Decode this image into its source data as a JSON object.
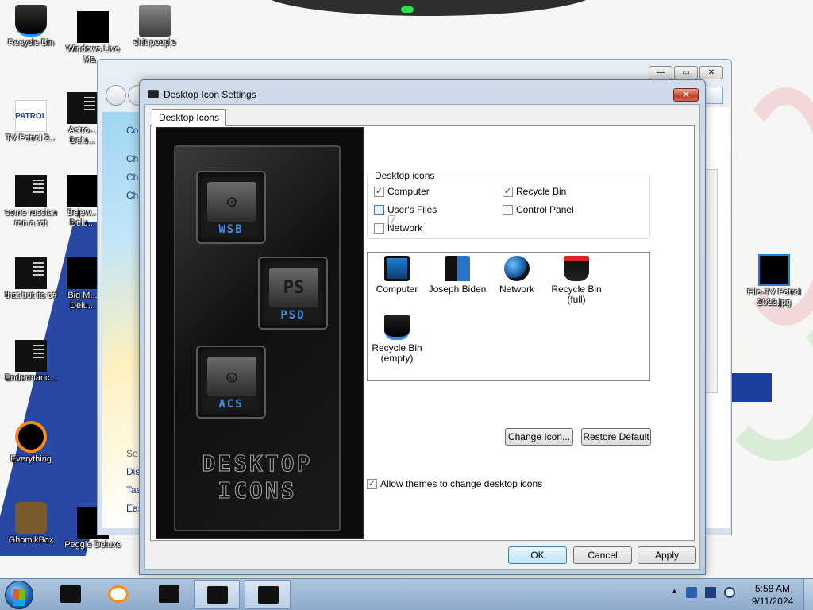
{
  "desktop": {
    "icons": [
      {
        "label": "Recycle Bin"
      },
      {
        "label": "Windows Live Ma..."
      },
      {
        "label": "shit people"
      },
      {
        "label": "TV Patrol 2..."
      },
      {
        "label": "Astro... Delu..."
      },
      {
        "label": "some russian ran a rat"
      },
      {
        "label": "Bejew... Delu..."
      },
      {
        "label": "that but its c#"
      },
      {
        "label": "Big M... Delu..."
      },
      {
        "label": "Endermanc..."
      },
      {
        "label": "Everything"
      },
      {
        "label": "GhomikBox"
      },
      {
        "label": "Peggle Deluxe"
      },
      {
        "label": "File-TV Patrol 2022.jpg"
      }
    ],
    "tv_logo": "PATROL"
  },
  "background_window": {
    "left_items": [
      "Co",
      "Ch",
      "Ch",
      "Ch",
      "Se",
      "Dis",
      "Tas",
      "Eas"
    ]
  },
  "dialog": {
    "title": "Desktop Icon Settings",
    "close_symbol": "✕",
    "tab_label": "Desktop Icons",
    "preview_art": {
      "tiles": [
        {
          "glyph": "⚙",
          "label": "WSB"
        },
        {
          "glyph": "PS",
          "label": "PSD"
        },
        {
          "glyph": "◎",
          "label": "ACS"
        }
      ],
      "title_line1": "DESKTOP",
      "title_line2": "ICONS"
    },
    "group_title": "Desktop icons",
    "checkboxes": [
      {
        "label": "Computer",
        "checked": true
      },
      {
        "label": "Recycle Bin",
        "checked": true
      },
      {
        "label": "User's Files",
        "checked": false
      },
      {
        "label": "Control Panel",
        "checked": false
      },
      {
        "label": "Network",
        "checked": false
      }
    ],
    "check_mark": "✓",
    "icon_list": [
      {
        "line1": "Computer",
        "line2": "",
        "icon": "monitor-icon"
      },
      {
        "line1": "Joseph Biden",
        "line2": "",
        "icon": "user-files-icon"
      },
      {
        "line1": "Network",
        "line2": "",
        "icon": "globe-icon"
      },
      {
        "line1": "Recycle Bin",
        "line2": "(full)",
        "icon": "recycle-bin-full-icon"
      },
      {
        "line1": "Recycle Bin",
        "line2": "(empty)",
        "icon": "recycle-bin-empty-icon"
      }
    ],
    "change_icon_label": "Change Icon...",
    "restore_default_label": "Restore Default",
    "allow_themes_label": "Allow themes to change desktop icons",
    "allow_themes_checked": true,
    "ok_label": "OK",
    "cancel_label": "Cancel",
    "apply_label": "Apply"
  },
  "taskbar": {
    "time": "5:58 AM",
    "date": "9/11/2024",
    "tray_arrow": "▲"
  },
  "colors": {
    "accent_blue": "#1b3f9e",
    "dialog_frame": "#b9cde2",
    "close_red": "#c4402a",
    "taskbar": "#9ab5d3"
  }
}
